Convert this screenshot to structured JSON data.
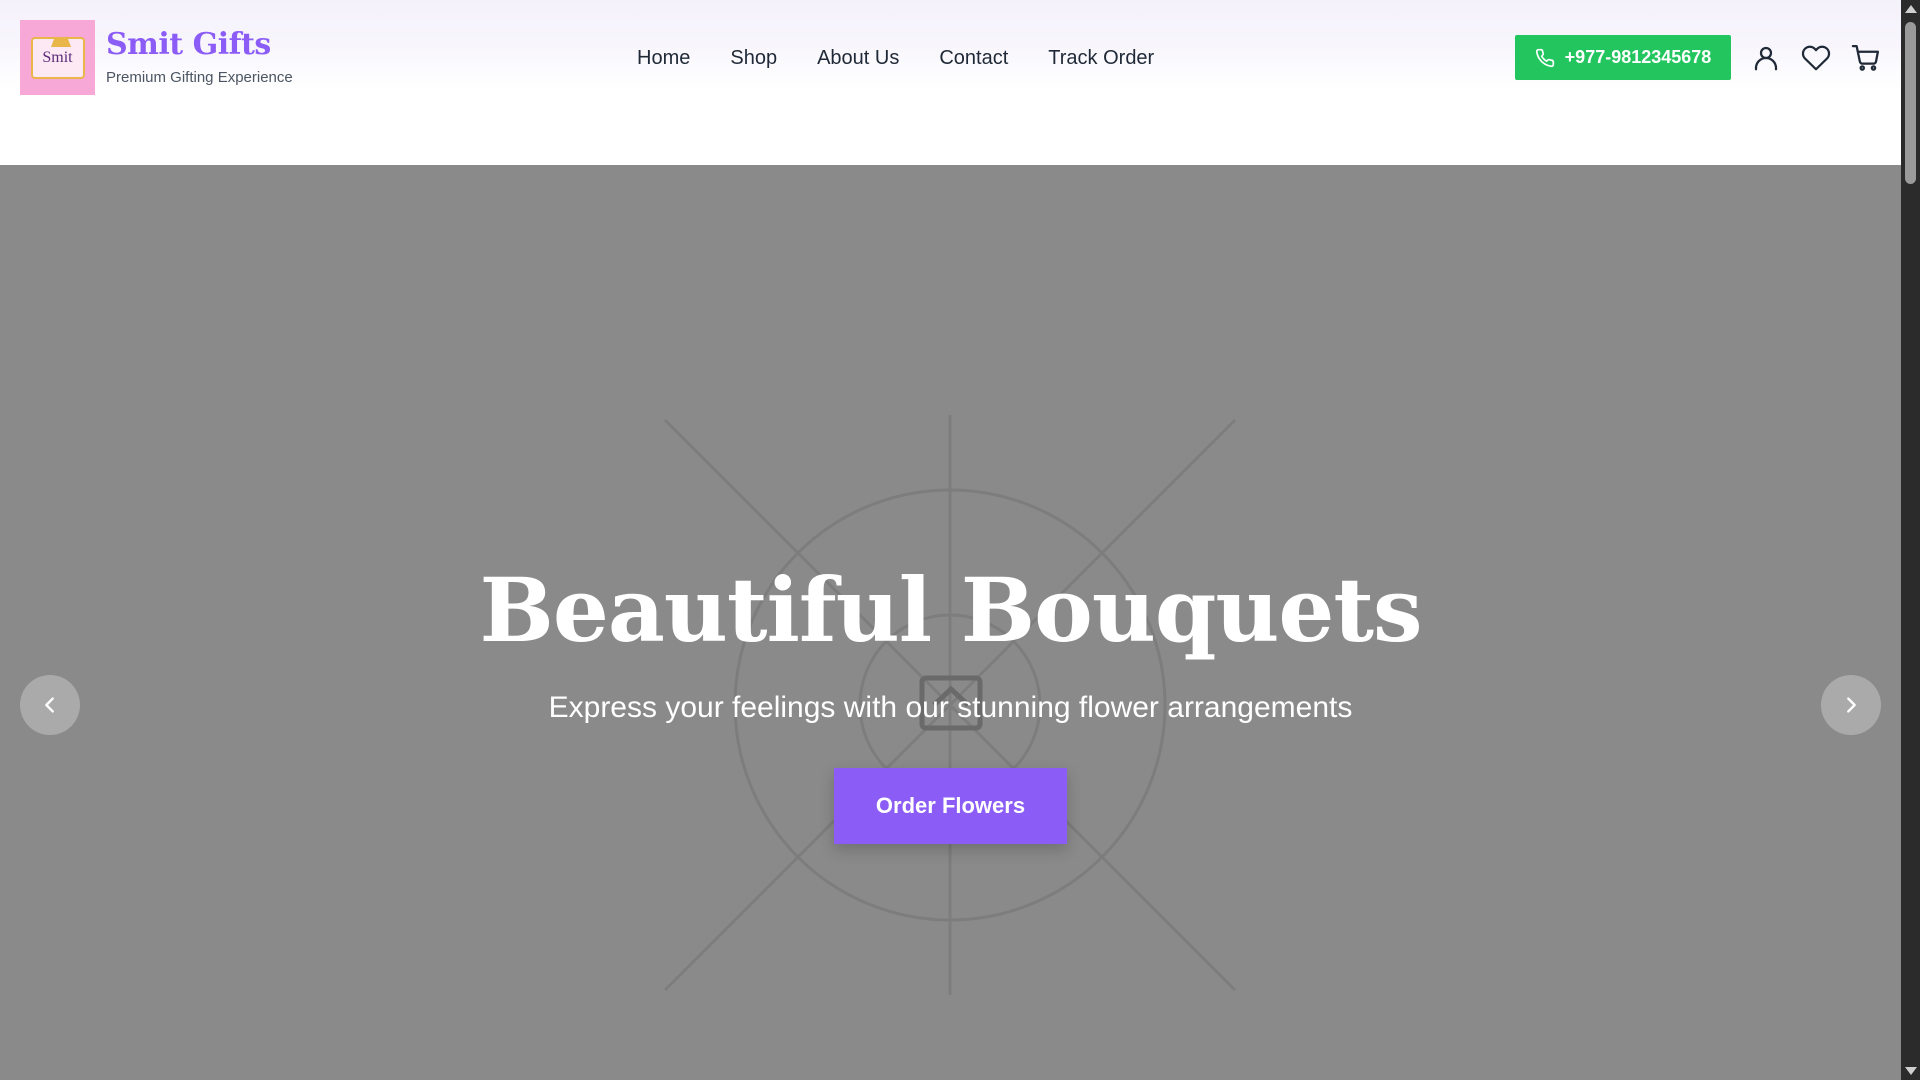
{
  "brand": {
    "logo_text": "Smit",
    "name": "Smit Gifts",
    "tagline": "Premium Gifting Experience"
  },
  "nav": {
    "items": [
      {
        "label": "Home"
      },
      {
        "label": "Shop"
      },
      {
        "label": "About Us"
      },
      {
        "label": "Contact"
      },
      {
        "label": "Track Order"
      }
    ]
  },
  "header_actions": {
    "phone": "+977-9812345678",
    "icons": [
      "user-icon",
      "heart-icon",
      "cart-icon"
    ]
  },
  "hero": {
    "title": "Beautiful Bouquets",
    "subtitle": "Express your feelings with our stunning flower arrangements",
    "cta_label": "Order Flowers",
    "placeholder_icon": "image-placeholder-icon"
  },
  "colors": {
    "brand_purple": "#8b5cf6",
    "phone_green": "#22c55e",
    "hero_gray": "#8a8a8a",
    "logo_pink": "#f7a8d6"
  }
}
